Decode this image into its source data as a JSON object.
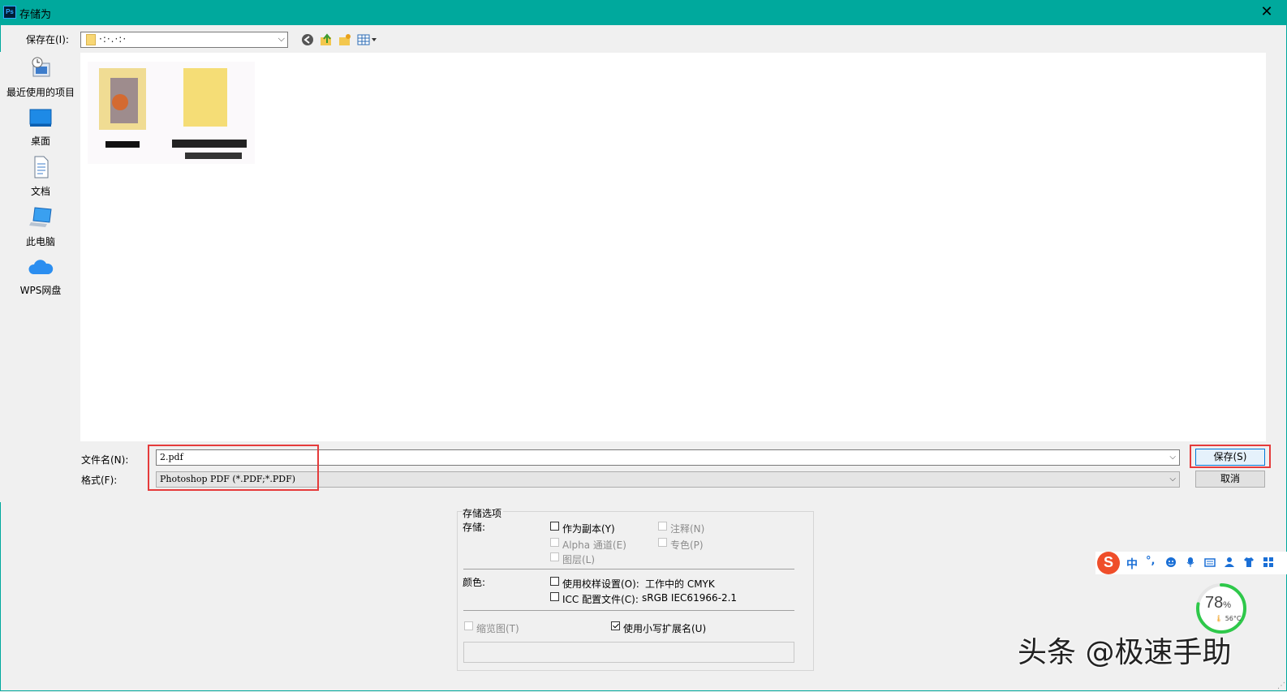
{
  "window": {
    "app_icon_text": "Ps",
    "title": "存储为",
    "close_glyph": "✕"
  },
  "toolbar": {
    "save_in_label": "保存在(I):",
    "location_value": "·:·.·:·",
    "combo_arrow": "⌵"
  },
  "sidebar": {
    "items": [
      {
        "label": "最近使用的项目",
        "icon": "recent-items-icon"
      },
      {
        "label": "桌面",
        "icon": "desktop-icon"
      },
      {
        "label": "文档",
        "icon": "documents-icon"
      },
      {
        "label": "此电脑",
        "icon": "this-pc-icon"
      },
      {
        "label": "WPS网盘",
        "icon": "wps-cloud-icon"
      }
    ]
  },
  "file_form": {
    "filename_label": "文件名(N):",
    "filename_value": "2.pdf",
    "format_label": "格式(F):",
    "format_value": "Photoshop PDF (*.PDF;*.PDF)",
    "arrow": "⌵",
    "save_button": "保存(S)",
    "cancel_button": "取消"
  },
  "options": {
    "group_title": "存储选项",
    "save_label": "存储:",
    "as_copy": "作为副本(Y)",
    "annotations": "注释(N)",
    "alpha_channels": "Alpha 通道(E)",
    "spot_colors": "专色(P)",
    "layers": "图层(L)",
    "color_label": "颜色:",
    "use_proof": "使用校样设置(O):",
    "proof_value": "工作中的 CMYK",
    "icc_profile": "ICC 配置文件(C):",
    "icc_value": "sRGB IEC61966-2.1",
    "thumbnail": "缩览图(T)",
    "lowercase_ext": "使用小写扩展名(U)",
    "lowercase_ext_checked": true
  },
  "ime": {
    "logo": "S",
    "mode": "中",
    "punct": "°,"
  },
  "gauge": {
    "percent": "78",
    "percent_sign": "%",
    "temperature": "56°C",
    "level": 0.78
  },
  "watermark": "头条 @极速手助",
  "colors": {
    "titlebar": "#00a99d",
    "highlight": "#e53b3b",
    "gauge": "#2ec84a"
  }
}
